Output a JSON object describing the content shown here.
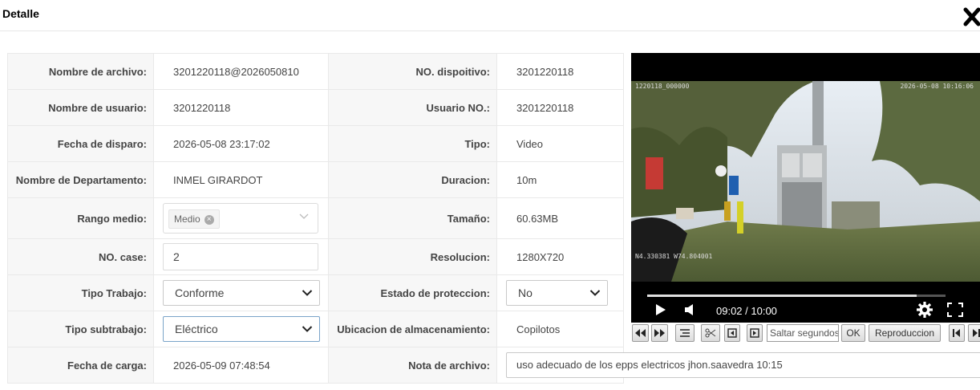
{
  "dialog": {
    "title": "Detalle",
    "close_icon": "close-icon"
  },
  "fields": {
    "nombre_archivo": {
      "label": "Nombre de archivo:",
      "value": "3201220118@2026050810"
    },
    "no_dispositivo": {
      "label": "NO. dispoitivo:",
      "value": "3201220118"
    },
    "nombre_usuario": {
      "label": "Nombre de usuario:",
      "value": "3201220118"
    },
    "usuario_no": {
      "label": "Usuario NO.:",
      "value": "3201220118"
    },
    "fecha_disparo": {
      "label": "Fecha de disparo:",
      "value": "2026-05-08 23:17:02"
    },
    "tipo": {
      "label": "Tipo:",
      "value": "Video"
    },
    "departamento": {
      "label": "Nombre de Departamento:",
      "value": "INMEL GIRARDOT"
    },
    "duracion": {
      "label": "Duracion:",
      "value": "10m"
    },
    "rango_medio": {
      "label": "Rango medio:",
      "tag": "Medio"
    },
    "tamano": {
      "label": "Tamaño:",
      "value": "60.63MB"
    },
    "no_case": {
      "label": "NO. case:",
      "value": "2"
    },
    "resolucion": {
      "label": "Resolucion:",
      "value": "1280X720"
    },
    "tipo_trabajo": {
      "label": "Tipo Trabajo:",
      "value": "Conforme"
    },
    "estado_proteccion": {
      "label": "Estado de proteccion:",
      "value": "No"
    },
    "tipo_subtrabajo": {
      "label": "Tipo subtrabajo:",
      "value": "Eléctrico"
    },
    "ubicacion": {
      "label": "Ubicacion de almacenamiento:",
      "value": "Copilotos"
    },
    "fecha_carga": {
      "label": "Fecha de carga:",
      "value": "2026-05-09 07:48:54"
    },
    "nota_archivo": {
      "label": "Nota de archivo:",
      "value": "uso adecuado de los epps electricos jhon.saavedra 10:15"
    }
  },
  "player": {
    "osd_top_left": "1220118_000000",
    "osd_top_right": "2026-05-08  10:16:06",
    "osd_bottom_left": "N4.330381  W74.804001",
    "time_display": "09:02 / 10:00",
    "progress_fraction": 0.903,
    "skip_placeholder": "Saltar segundos",
    "ok_label": "OK",
    "playback_label": "Reproduccion"
  }
}
